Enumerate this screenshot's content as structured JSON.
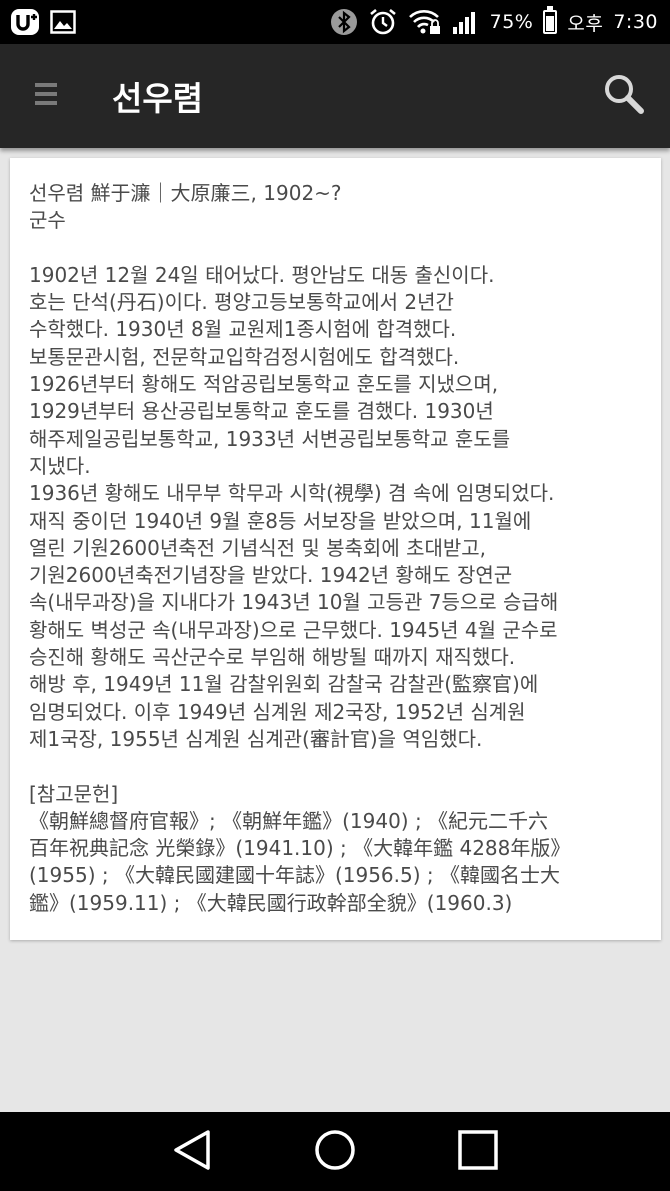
{
  "status_bar": {
    "battery_percent": "75%",
    "ampm": "오후",
    "time": "7:30",
    "battery_level": 0.75,
    "icons": [
      "carrier-u-plus-icon",
      "image-notification-icon",
      "bluetooth-icon",
      "alarm-icon",
      "wifi-lock-icon",
      "signal-icon",
      "battery-icon"
    ]
  },
  "app_bar": {
    "title": "선우렴",
    "menu_icon": "hamburger-menu-icon",
    "search_icon": "search-icon",
    "color": "#262626"
  },
  "article": {
    "header_line": "선우렴 鮮于濂｜大原廉三, 1902~?",
    "occupation": "군수",
    "body_lines": [
      "1902년 12월 24일 태어났다. 평안남도 대동 출신이다.",
      "호는 단석(丹石)이다. 평양고등보통학교에서 2년간",
      "수학했다. 1930년 8월 교원제1종시험에 합격했다.",
      "보통문관시험, 전문학교입학검정시험에도 합격했다.",
      "1926년부터 황해도 적암공립보통학교 훈도를 지냈으며,",
      "1929년부터 용산공립보통학교 훈도를 겸했다. 1930년",
      "해주제일공립보통학교, 1933년 서변공립보통학교 훈도를",
      "지냈다.",
      "1936년 황해도 내무부 학무과 시학(視學) 겸 속에 임명되었다.",
      "재직 중이던 1940년 9월 훈8등 서보장을 받았으며, 11월에",
      "열린 기원2600년축전 기념식전 및 봉축회에 초대받고,",
      "기원2600년축전기념장을 받았다. 1942년 황해도 장연군",
      "속(내무과장)을 지내다가 1943년 10월 고등관 7등으로 승급해",
      "황해도 벽성군 속(내무과장)으로 근무했다. 1945년 4월 군수로",
      "승진해 황해도 곡산군수로 부임해 해방될 때까지 재직했다.",
      "해방 후, 1949년 11월 감찰위원회 감찰국 감찰관(監察官)에",
      "임명되었다. 이후 1949년 심계원 제2국장, 1952년 심계원",
      "제1국장, 1955년 심계원 심계관(審計官)을 역임했다."
    ],
    "references_heading": "[참고문헌]",
    "references_lines": [
      "《朝鮮總督府官報》; 《朝鮮年鑑》(1940) ; 《紀元二千六",
      "百年祝典記念 光榮錄》(1941.10) ; 《大韓年鑑 4288年版》",
      "(1955) ; 《大韓民國建國十年誌》(1956.5) ; 《韓國名士大",
      "鑑》(1959.11) ; 《大韓民國行政幹部全貌》(1960.3)"
    ]
  },
  "nav_bar": {
    "back_icon": "back-triangle-icon",
    "home_icon": "home-circle-icon",
    "recents_icon": "recents-square-icon"
  }
}
